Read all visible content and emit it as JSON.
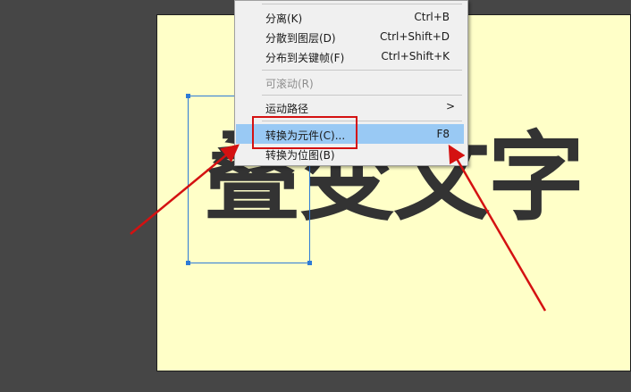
{
  "canvas": {
    "headline": "叠变文字",
    "stage_color": "#ffffc8",
    "workspace_color": "#464646",
    "selection_color": "#2e7bd6"
  },
  "context_menu": {
    "items": [
      {
        "label": "分离(K)",
        "shortcut": "Ctrl+B"
      },
      {
        "label": "分散到图层(D)",
        "shortcut": "Ctrl+Shift+D"
      },
      {
        "label": "分布到关键帧(F)",
        "shortcut": "Ctrl+Shift+K"
      },
      {
        "label": "可滚动(R)",
        "shortcut": "",
        "disabled": true
      },
      {
        "label": "运动路径",
        "submenu_icon": ">"
      },
      {
        "label": "转换为元件(C)...",
        "shortcut": "F8",
        "highlighted": true
      },
      {
        "label": "转换为位图(B)",
        "shortcut": ""
      }
    ]
  },
  "annotations": {
    "highlight_box_color": "#d41111",
    "arrow_color": "#d41111"
  }
}
